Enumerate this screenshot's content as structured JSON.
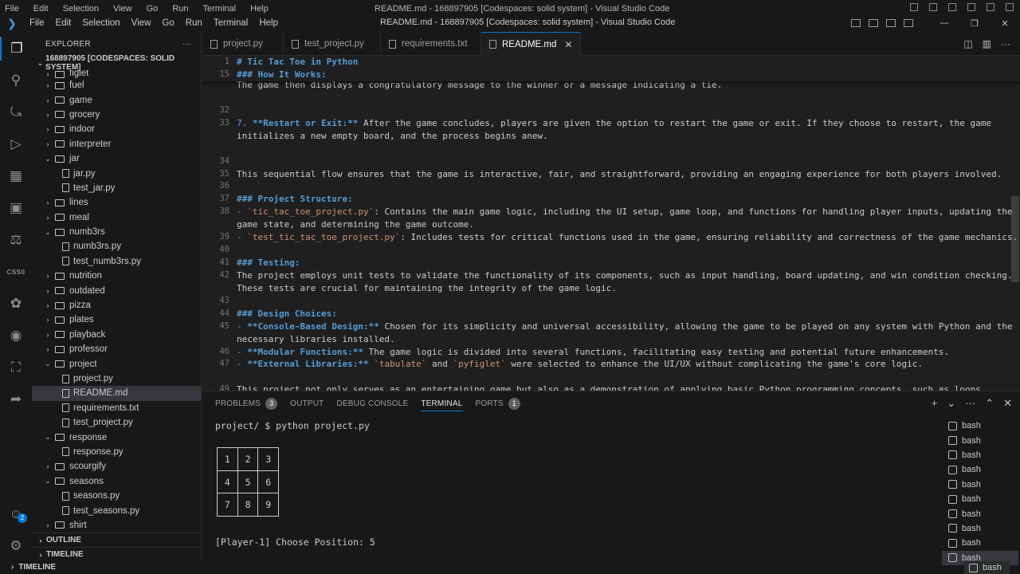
{
  "ghost_bar": {
    "menu": [
      "File",
      "Edit",
      "Selection",
      "View",
      "Go",
      "Run",
      "Terminal",
      "Help"
    ],
    "title": "README.md - 168897905 [Codespaces: solid system] - Visual Studio Code"
  },
  "title_bar": {
    "menu": [
      "File",
      "Edit",
      "Selection",
      "View",
      "Go",
      "Run",
      "Terminal",
      "Help"
    ],
    "title": "README.md - 168897905 [Codespaces: solid system] - Visual Studio Code",
    "minimize": "—",
    "maximize": "❐",
    "close": "✕"
  },
  "activity_bar": {
    "icons": [
      "explorer-icon",
      "search-icon",
      "source-control-icon",
      "run-debug-icon",
      "extensions-icon",
      "remote-explorer-icon",
      "testing-icon",
      "css0-icon",
      "cs50-duck-icon",
      "github-icon",
      "docker-icon",
      "live-share-icon",
      "accounts-icon",
      "settings-icon"
    ],
    "css_label": "CSS0",
    "accounts_badge": "2"
  },
  "sidebar": {
    "header": "EXPLORER",
    "more": "···",
    "root": "168897905 [CODESPACES: SOLID SYSTEM]",
    "tree": [
      {
        "name": "figlet",
        "type": "folder",
        "level": 1,
        "open": false,
        "cut": true
      },
      {
        "name": "fuel",
        "type": "folder",
        "level": 1,
        "open": false
      },
      {
        "name": "game",
        "type": "folder",
        "level": 1,
        "open": false
      },
      {
        "name": "grocery",
        "type": "folder",
        "level": 1,
        "open": false
      },
      {
        "name": "indoor",
        "type": "folder",
        "level": 1,
        "open": false
      },
      {
        "name": "interpreter",
        "type": "folder",
        "level": 1,
        "open": false
      },
      {
        "name": "jar",
        "type": "folder",
        "level": 1,
        "open": true
      },
      {
        "name": "jar.py",
        "type": "file",
        "level": 2
      },
      {
        "name": "test_jar.py",
        "type": "file",
        "level": 2
      },
      {
        "name": "lines",
        "type": "folder",
        "level": 1,
        "open": false
      },
      {
        "name": "meal",
        "type": "folder",
        "level": 1,
        "open": false
      },
      {
        "name": "numb3rs",
        "type": "folder",
        "level": 1,
        "open": true
      },
      {
        "name": "numb3rs.py",
        "type": "file",
        "level": 2
      },
      {
        "name": "test_numb3rs.py",
        "type": "file",
        "level": 2
      },
      {
        "name": "nutrition",
        "type": "folder",
        "level": 1,
        "open": false
      },
      {
        "name": "outdated",
        "type": "folder",
        "level": 1,
        "open": false
      },
      {
        "name": "pizza",
        "type": "folder",
        "level": 1,
        "open": false
      },
      {
        "name": "plates",
        "type": "folder",
        "level": 1,
        "open": false
      },
      {
        "name": "playback",
        "type": "folder",
        "level": 1,
        "open": false
      },
      {
        "name": "professor",
        "type": "folder",
        "level": 1,
        "open": false
      },
      {
        "name": "project",
        "type": "folder",
        "level": 1,
        "open": true
      },
      {
        "name": "project.py",
        "type": "file",
        "level": 2
      },
      {
        "name": "README.md",
        "type": "file",
        "level": 2,
        "selected": true
      },
      {
        "name": "requirements.txt",
        "type": "file",
        "level": 2
      },
      {
        "name": "test_project.py",
        "type": "file",
        "level": 2
      },
      {
        "name": "response",
        "type": "folder",
        "level": 1,
        "open": true
      },
      {
        "name": "response.py",
        "type": "file",
        "level": 2
      },
      {
        "name": "scourgify",
        "type": "folder",
        "level": 1,
        "open": false
      },
      {
        "name": "seasons",
        "type": "folder",
        "level": 1,
        "open": true
      },
      {
        "name": "seasons.py",
        "type": "file",
        "level": 2
      },
      {
        "name": "test_seasons.py",
        "type": "file",
        "level": 2
      },
      {
        "name": "shirt",
        "type": "folder",
        "level": 1,
        "open": false
      }
    ],
    "outline": "OUTLINE",
    "timeline": "TIMELINE"
  },
  "bottom_ghost": {
    "timeline": "TIMELINE"
  },
  "tabs": [
    {
      "label": "project.py",
      "active": false
    },
    {
      "label": "test_project.py",
      "active": false
    },
    {
      "label": "requirements.txt",
      "active": false
    },
    {
      "label": "README.md",
      "active": true
    }
  ],
  "editor": {
    "sticky": [
      {
        "ln": "1",
        "segments": [
          {
            "t": "# Tic Tac Toe in Python",
            "c": "h"
          }
        ]
      },
      {
        "ln": "15",
        "segments": [
          {
            "t": "### How It Works:",
            "c": "h"
          }
        ]
      }
    ],
    "lines": [
      {
        "ln": "",
        "segments": [
          {
            "t": "The game then displays a congratulatory message to the winner or a message indicating a tie.",
            "c": ""
          }
        ]
      },
      {
        "ln": "",
        "segments": []
      },
      {
        "ln": "32",
        "segments": []
      },
      {
        "ln": "33",
        "segments": [
          {
            "t": "7. ",
            "c": "ms"
          },
          {
            "t": "**Restart or Exit:**",
            "c": "b"
          },
          {
            "t": " After the game concludes, players are given the option to restart the game or exit. If they choose to restart, the game",
            "c": ""
          }
        ]
      },
      {
        "ln": "",
        "segments": [
          {
            "t": "initializes a new empty board, and the process begins anew.",
            "c": ""
          }
        ]
      },
      {
        "ln": "",
        "segments": []
      },
      {
        "ln": "34",
        "segments": []
      },
      {
        "ln": "35",
        "segments": [
          {
            "t": "This sequential flow ensures that the game is interactive, fair, and straightforward, providing an engaging experience for both players involved.",
            "c": ""
          }
        ]
      },
      {
        "ln": "36",
        "segments": []
      },
      {
        "ln": "37",
        "segments": [
          {
            "t": "### Project Structure:",
            "c": "h"
          }
        ]
      },
      {
        "ln": "38",
        "segments": [
          {
            "t": "- ",
            "c": "ms"
          },
          {
            "t": "`tic_tac_toe_project.py`",
            "c": "ic"
          },
          {
            "t": ": Contains the main game logic, including the UI setup, game loop, and functions for handling player inputs, updating the",
            "c": ""
          }
        ]
      },
      {
        "ln": "",
        "segments": [
          {
            "t": "game state, and determining the game outcome.",
            "c": ""
          }
        ]
      },
      {
        "ln": "39",
        "segments": [
          {
            "t": "- ",
            "c": "ms"
          },
          {
            "t": "`test_tic_tac_toe_project.py`",
            "c": "ic"
          },
          {
            "t": ": Includes tests for critical functions used in the game, ensuring reliability and correctness of the game mechanics.",
            "c": ""
          }
        ]
      },
      {
        "ln": "40",
        "segments": []
      },
      {
        "ln": "41",
        "segments": [
          {
            "t": "### Testing:",
            "c": "h"
          }
        ]
      },
      {
        "ln": "42",
        "segments": [
          {
            "t": "The project employs unit tests to validate the functionality of its components, such as input handling, board updating, and win condition checking.",
            "c": ""
          }
        ]
      },
      {
        "ln": "",
        "segments": [
          {
            "t": "These tests are crucial for maintaining the integrity of the game logic.",
            "c": ""
          }
        ]
      },
      {
        "ln": "43",
        "segments": []
      },
      {
        "ln": "44",
        "segments": [
          {
            "t": "### Design Choices:",
            "c": "h"
          }
        ]
      },
      {
        "ln": "45",
        "segments": [
          {
            "t": "- ",
            "c": "ms"
          },
          {
            "t": "**Console-Based Design:**",
            "c": "b"
          },
          {
            "t": " Chosen for its simplicity and universal accessibility, allowing the game to be played on any system with Python and the",
            "c": ""
          }
        ]
      },
      {
        "ln": "",
        "segments": [
          {
            "t": "necessary libraries installed.",
            "c": ""
          }
        ]
      },
      {
        "ln": "46",
        "segments": [
          {
            "t": "- ",
            "c": "ms"
          },
          {
            "t": "**Modular Functions:**",
            "c": "b"
          },
          {
            "t": " The game logic is divided into several functions, facilitating easy testing and potential future enhancements.",
            "c": ""
          }
        ]
      },
      {
        "ln": "47",
        "segments": [
          {
            "t": "- ",
            "c": "ms"
          },
          {
            "t": "**External Libraries:**",
            "c": "b"
          },
          {
            "t": " ",
            "c": ""
          },
          {
            "t": "`tabulate`",
            "c": "ic"
          },
          {
            "t": " and ",
            "c": ""
          },
          {
            "t": "`pyfiglet`",
            "c": "ic"
          },
          {
            "t": " were selected to enhance the UI/UX without complicating the game's core logic.",
            "c": ""
          }
        ]
      },
      {
        "ln": "",
        "segments": []
      },
      {
        "ln": "49",
        "segments": [
          {
            "t": "This project not only serves as an entertaining game but also as a demonstration of applying basic Python programming concepts, such as loops,",
            "c": ""
          }
        ]
      },
      {
        "ln": "",
        "segments": [
          {
            "t": "conditionals, and function calls, in creating an interactive application.",
            "c": ""
          }
        ]
      }
    ]
  },
  "panel": {
    "tabs": [
      {
        "label": "PROBLEMS",
        "count": "3"
      },
      {
        "label": "OUTPUT"
      },
      {
        "label": "DEBUG CONSOLE"
      },
      {
        "label": "TERMINAL",
        "active": true
      },
      {
        "label": "PORTS",
        "count": "1"
      }
    ],
    "actions": [
      "+",
      "⌄",
      "···",
      "⌃",
      "✕"
    ],
    "terminal": {
      "command_line": "project/ $ python project.py",
      "board": [
        [
          "1",
          "2",
          "3"
        ],
        [
          "4",
          "5",
          "6"
        ],
        [
          "7",
          "8",
          "9"
        ]
      ],
      "prompt": "[Player-1] Choose Position: 5"
    },
    "terminal_list": [
      "bash",
      "bash",
      "bash",
      "bash",
      "bash",
      "bash",
      "bash",
      "bash",
      "bash",
      "bash"
    ],
    "terminal_ghost": "bash"
  }
}
